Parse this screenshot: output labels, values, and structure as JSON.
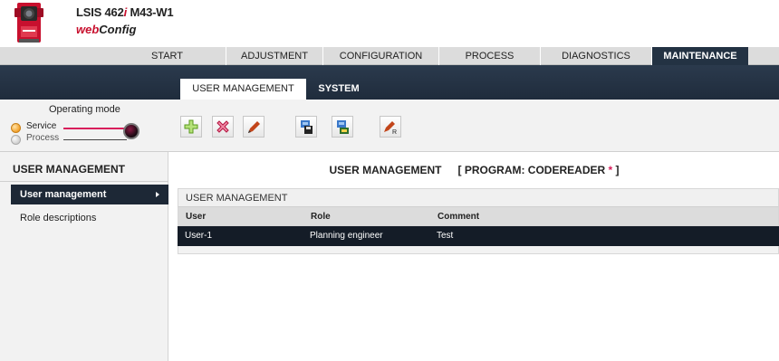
{
  "header": {
    "product_prefix": "LSIS 462",
    "product_italic": "i",
    "product_suffix": " M43-W1",
    "webconfig_web": "web",
    "webconfig_config": "Config"
  },
  "main_tabs": [
    {
      "label": "START"
    },
    {
      "label": "ADJUSTMENT"
    },
    {
      "label": "CONFIGURATION"
    },
    {
      "label": "PROCESS"
    },
    {
      "label": "DIAGNOSTICS"
    },
    {
      "label": "MAINTENANCE"
    }
  ],
  "main_active": "MAINTENANCE",
  "sub_tabs": [
    {
      "label": "USER MANAGEMENT"
    },
    {
      "label": "SYSTEM"
    }
  ],
  "sub_active": "USER MANAGEMENT",
  "operating_mode": {
    "title": "Operating mode",
    "service_label": "Service",
    "process_label": "Process",
    "selected": "Service"
  },
  "toolbar_icons": [
    "add-icon",
    "delete-icon",
    "edit-icon",
    "save-to-device-icon",
    "load-from-device-icon",
    "edit-role-icon"
  ],
  "sidebar": {
    "title": "USER MANAGEMENT",
    "items": [
      {
        "label": "User management"
      },
      {
        "label": "Role descriptions"
      }
    ]
  },
  "content": {
    "title": "USER MANAGEMENT",
    "program_label": "[ PROGRAM: CODEREADER",
    "program_star": "*",
    "program_close": "]",
    "table_caption": "USER MANAGEMENT",
    "columns": [
      "User",
      "Role",
      "Comment"
    ],
    "rows": [
      {
        "user": "User-1",
        "role": "Planning engineer",
        "comment": "Test"
      }
    ]
  },
  "colors": {
    "dark_navy": "#233243",
    "brand_red": "#c8102e",
    "service_line": "#d81e5b",
    "led_orange": "#f2a12b"
  }
}
